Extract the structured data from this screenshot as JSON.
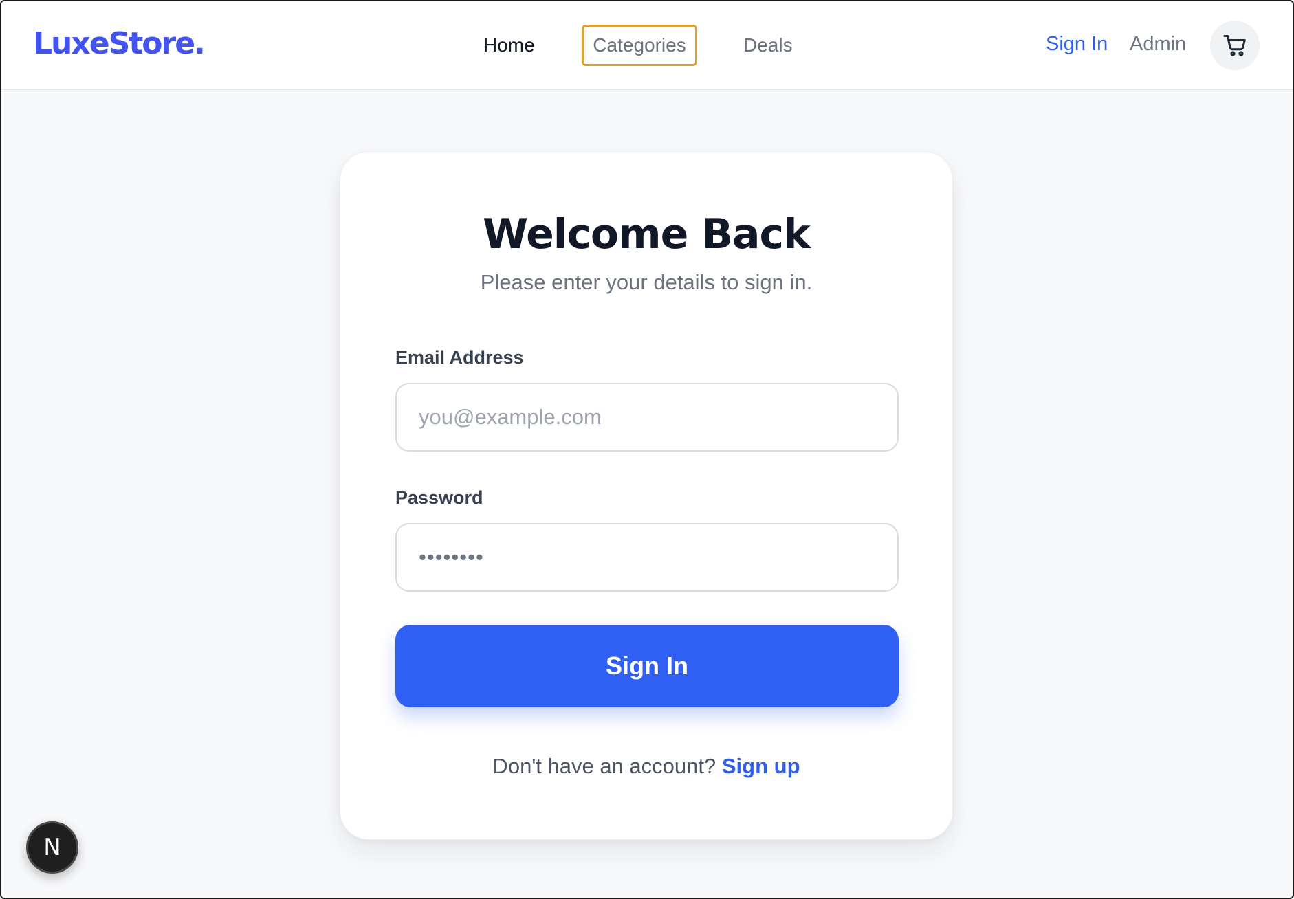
{
  "header": {
    "logo": "LuxeStore.",
    "nav": {
      "home": "Home",
      "categories": "Categories",
      "deals": "Deals"
    },
    "sign_in": "Sign In",
    "admin": "Admin",
    "cart_icon": "cart-icon"
  },
  "login": {
    "title": "Welcome Back",
    "subtitle": "Please enter your details to sign in.",
    "email_label": "Email Address",
    "email_placeholder": "you@example.com",
    "password_label": "Password",
    "password_placeholder": "••••••••",
    "submit_label": "Sign In",
    "footer_prompt": "Don't have an account?",
    "signup_link": "Sign up"
  },
  "badge": {
    "letter": "N"
  },
  "colors": {
    "brand": "#4353f0",
    "primary": "#2f5ff3",
    "link": "#2f5fe8",
    "focus_outline": "#e0a030"
  }
}
